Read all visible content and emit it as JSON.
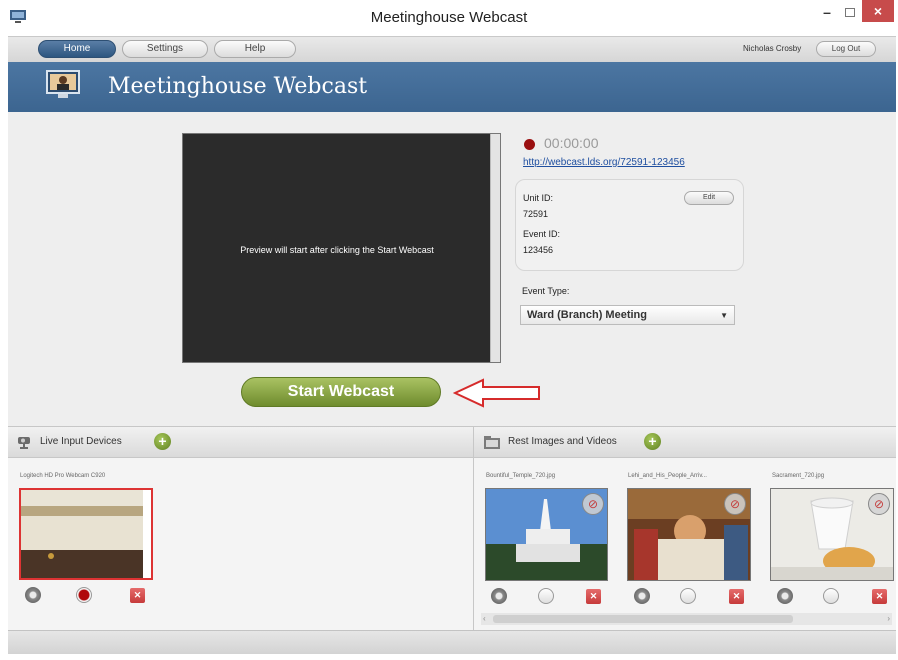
{
  "window": {
    "title": "Meetinghouse Webcast",
    "close_glyph": "×",
    "minimize_glyph": "–"
  },
  "nav": {
    "tabs": [
      {
        "label": "Home",
        "active": true
      },
      {
        "label": "Settings",
        "active": false
      },
      {
        "label": "Help",
        "active": false
      }
    ],
    "user_name": "Nicholas Crosby",
    "logout_label": "Log Out"
  },
  "header": {
    "title": "Meetinghouse Webcast",
    "icon": "broadcast-presenter-icon"
  },
  "preview": {
    "message": "Preview will start after clicking the Start Webcast"
  },
  "start_button": {
    "label": "Start Webcast"
  },
  "status": {
    "timer": "00:00:00",
    "url": "http://webcast.lds.org/72591-123456",
    "unit_id_label": "Unit ID:",
    "unit_id": "72591",
    "event_id_label": "Event ID:",
    "event_id": "123456",
    "edit_label": "Edit",
    "event_type_label": "Event Type:",
    "event_type_value": "Ward (Branch) Meeting"
  },
  "live_panel": {
    "title": "Live Input Devices",
    "devices": [
      {
        "label": "Logitech HD Pro Webcam C920"
      }
    ]
  },
  "rest_panel": {
    "title": "Rest Images and Videos",
    "items": [
      {
        "label": "Bountiful_Temple_720.jpg"
      },
      {
        "label": "Lehi_and_His_People_Arriv..."
      },
      {
        "label": "Sacrament_720.jpg"
      }
    ]
  },
  "colors": {
    "header_blue": "#4c76a2",
    "active_tab": "#3b628c",
    "record_red": "#9a0f10",
    "start_green": "#8aa843",
    "delete_red": "#d34c4c"
  }
}
